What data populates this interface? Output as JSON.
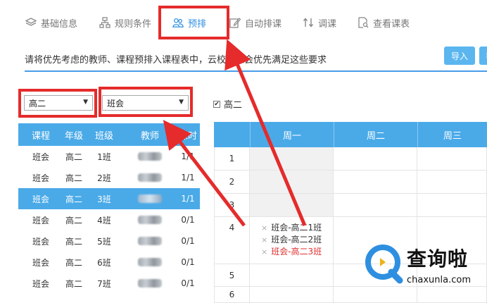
{
  "tabs": [
    {
      "label": "基础信息",
      "icon": "layers-icon"
    },
    {
      "label": "规则条件",
      "icon": "sitemap-icon"
    },
    {
      "label": "预排",
      "icon": "users-icon",
      "active": true
    },
    {
      "label": "自动排课",
      "icon": "edit-icon"
    },
    {
      "label": "调课",
      "icon": "swap-icon"
    },
    {
      "label": "查看课表",
      "icon": "search-doc-icon"
    }
  ],
  "description": "请将优先考虑的教师、课程预排入课程表中，云校排课会优先满足这些要求",
  "buttons": {
    "import_label": "导入",
    "next_label": "导"
  },
  "filters": {
    "grade_value": "高二",
    "course_value": "班会"
  },
  "left_table": {
    "headers": [
      "课程",
      "年级",
      "班级",
      "教师",
      "课时"
    ],
    "rows": [
      {
        "course": "班会",
        "grade": "高二",
        "class": "1班",
        "hours": "1/1",
        "selected": false
      },
      {
        "course": "班会",
        "grade": "高二",
        "class": "2班",
        "hours": "1/1",
        "selected": false
      },
      {
        "course": "班会",
        "grade": "高二",
        "class": "3班",
        "hours": "1/1",
        "selected": true
      },
      {
        "course": "班会",
        "grade": "高二",
        "class": "4班",
        "hours": "0/1",
        "selected": false
      },
      {
        "course": "班会",
        "grade": "高二",
        "class": "5班",
        "hours": "0/1",
        "selected": false
      },
      {
        "course": "班会",
        "grade": "高二",
        "class": "6班",
        "hours": "0/1",
        "selected": false
      },
      {
        "course": "班会",
        "grade": "高二",
        "class": "7班",
        "hours": "0/1",
        "selected": false
      }
    ]
  },
  "checkbox": {
    "label": "高二",
    "checked": true
  },
  "schedule": {
    "days": [
      "周一",
      "周二",
      "周三"
    ],
    "periods": [
      "1",
      "2",
      "3",
      "4",
      "5",
      "6"
    ],
    "entries_period_4_monday": [
      {
        "text": "班会-高二1班",
        "color": "#333333"
      },
      {
        "text": "班会-高二2班",
        "color": "#333333"
      },
      {
        "text": "班会-高二3班",
        "color": "#e03030"
      }
    ]
  },
  "colors": {
    "accent": "#4aaae8",
    "highlight": "#e52b2b",
    "active_tab": "#2d8ee0",
    "watermark_blue": "#2e8fe0"
  },
  "watermark": {
    "cn": "查询啦",
    "en": "chaxunla.com"
  }
}
